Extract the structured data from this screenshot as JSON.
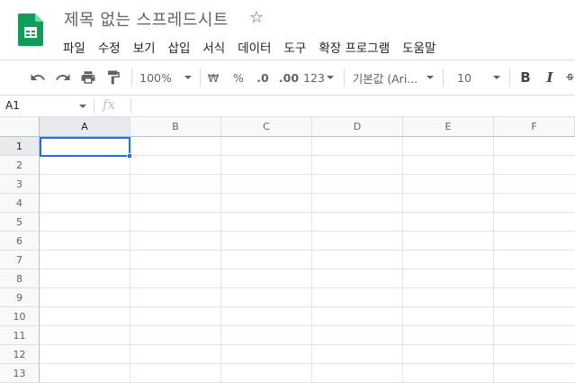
{
  "document": {
    "title": "제목 없는 스프레드시트"
  },
  "menu": [
    "파일",
    "수정",
    "보기",
    "삽입",
    "서식",
    "데이터",
    "도구",
    "확장 프로그램",
    "도움말"
  ],
  "toolbar": {
    "zoom": "100%",
    "currency": "₩",
    "percent": "%",
    "decrease_decimal": ".0",
    "increase_decimal": ".00",
    "more_formats": "123",
    "font": "기본값 (Ari...",
    "font_size": "10",
    "bold": "B",
    "italic": "I"
  },
  "formula_bar": {
    "cell_ref": "A1",
    "fx": "fx",
    "value": ""
  },
  "grid": {
    "columns": [
      "A",
      "B",
      "C",
      "D",
      "E",
      "F"
    ],
    "rows": [
      "1",
      "2",
      "3",
      "4",
      "5",
      "6",
      "7",
      "8",
      "9",
      "10",
      "11",
      "12",
      "13"
    ],
    "selected_cell": "A1"
  },
  "colors": {
    "accent": "#1a73e8",
    "logo": "#0f9d58"
  }
}
